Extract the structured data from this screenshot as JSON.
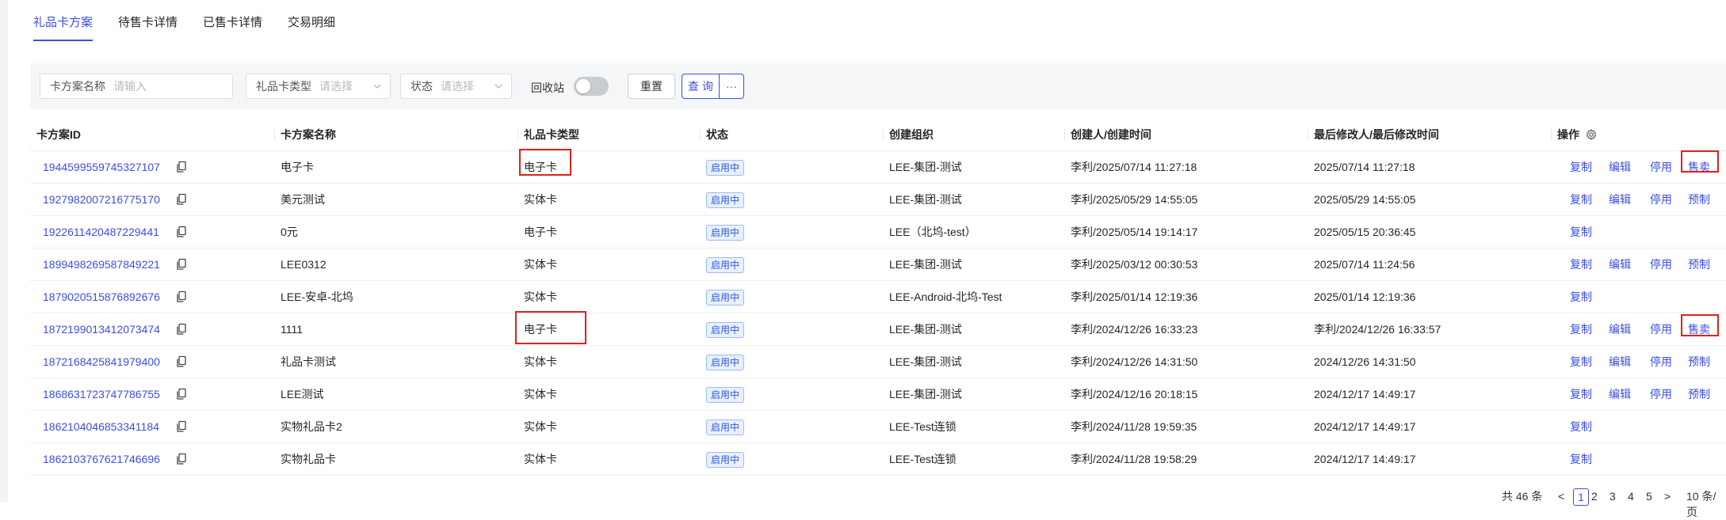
{
  "tabs": [
    {
      "label": "礼品卡方案",
      "active": true
    },
    {
      "label": "待售卡详情",
      "active": false
    },
    {
      "label": "已售卡详情",
      "active": false
    },
    {
      "label": "交易明细",
      "active": false
    }
  ],
  "filters": {
    "name": {
      "label": "卡方案名称",
      "placeholder": "请输入"
    },
    "type": {
      "label": "礼品卡类型",
      "placeholder": "请选择"
    },
    "status": {
      "label": "状态",
      "placeholder": "请选择"
    },
    "recycle": {
      "label": "回收站",
      "on": false
    },
    "reset_label": "重置",
    "query_label": "查 询",
    "more_label": "···"
  },
  "table": {
    "columns": [
      "卡方案ID",
      "卡方案名称",
      "礼品卡类型",
      "状态",
      "创建组织",
      "创建人/创建时间",
      "最后修改人/最后修改时间",
      "操作"
    ],
    "rows": [
      {
        "id": "1944599559745327107",
        "name": "电子卡",
        "type": "电子卡",
        "status": "启用中",
        "org": "LEE-集团-测试",
        "created": "李利/2025/07/14 11:27:18",
        "modified": "2025/07/14 11:27:18",
        "ops": [
          "复制",
          "编辑",
          "停用",
          "售卖"
        ]
      },
      {
        "id": "1927982007216775170",
        "name": "美元测试",
        "type": "实体卡",
        "status": "启用中",
        "org": "LEE-集团-测试",
        "created": "李利/2025/05/29 14:55:05",
        "modified": "2025/05/29 14:55:05",
        "ops": [
          "复制",
          "编辑",
          "停用",
          "预制"
        ]
      },
      {
        "id": "1922611420487229441",
        "name": "0元",
        "type": "电子卡",
        "status": "启用中",
        "org": "LEE（北坞-test）",
        "created": "李利/2025/05/14 19:14:17",
        "modified": "2025/05/15 20:36:45",
        "ops": [
          "复制"
        ]
      },
      {
        "id": "1899498269587849221",
        "name": "LEE0312",
        "type": "实体卡",
        "status": "启用中",
        "org": "LEE-集团-测试",
        "created": "李利/2025/03/12 00:30:53",
        "modified": "2025/07/14 11:24:56",
        "ops": [
          "复制",
          "编辑",
          "停用",
          "预制"
        ]
      },
      {
        "id": "1879020515876892676",
        "name": "LEE-安卓-北坞",
        "type": "实体卡",
        "status": "启用中",
        "org": "LEE-Android-北坞-Test",
        "created": "李利/2025/01/14 12:19:36",
        "modified": "2025/01/14 12:19:36",
        "ops": [
          "复制"
        ]
      },
      {
        "id": "1872199013412073474",
        "name": "1111",
        "type": "电子卡",
        "status": "启用中",
        "org": "LEE-集团-测试",
        "created": "李利/2024/12/26 16:33:23",
        "modified": "李利/2024/12/26 16:33:57",
        "ops": [
          "复制",
          "编辑",
          "停用",
          "售卖"
        ]
      },
      {
        "id": "1872168425841979400",
        "name": "礼品卡测试",
        "type": "实体卡",
        "status": "启用中",
        "org": "LEE-集团-测试",
        "created": "李利/2024/12/26 14:31:50",
        "modified": "2024/12/26 14:31:50",
        "ops": [
          "复制",
          "编辑",
          "停用",
          "预制"
        ]
      },
      {
        "id": "1868631723747786755",
        "name": "LEE测试",
        "type": "实体卡",
        "status": "启用中",
        "org": "LEE-集团-测试",
        "created": "李利/2024/12/16 20:18:15",
        "modified": "2024/12/17 14:49:17",
        "ops": [
          "复制",
          "编辑",
          "停用",
          "预制"
        ]
      },
      {
        "id": "1862104046853341184",
        "name": "实物礼品卡2",
        "type": "实体卡",
        "status": "启用中",
        "org": "LEE-Test连锁",
        "created": "李利/2024/11/28 19:59:35",
        "modified": "2024/12/17 14:49:17",
        "ops": [
          "复制"
        ]
      },
      {
        "id": "1862103767621746696",
        "name": "实物礼品卡",
        "type": "实体卡",
        "status": "启用中",
        "org": "LEE-Test连锁",
        "created": "李利/2024/11/28 19:58:29",
        "modified": "2024/12/17 14:49:17",
        "ops": [
          "复制"
        ]
      }
    ]
  },
  "pagination": {
    "total": "共 46 条",
    "prev": "<",
    "pages": [
      "1",
      "2",
      "3",
      "4",
      "5"
    ],
    "current": "1",
    "next": ">",
    "page_size": "10 条/页"
  },
  "colors": {
    "accent": "#3b4ee0",
    "highlight_box": "#e0201c",
    "badge_bg": "#e8f0fe"
  }
}
